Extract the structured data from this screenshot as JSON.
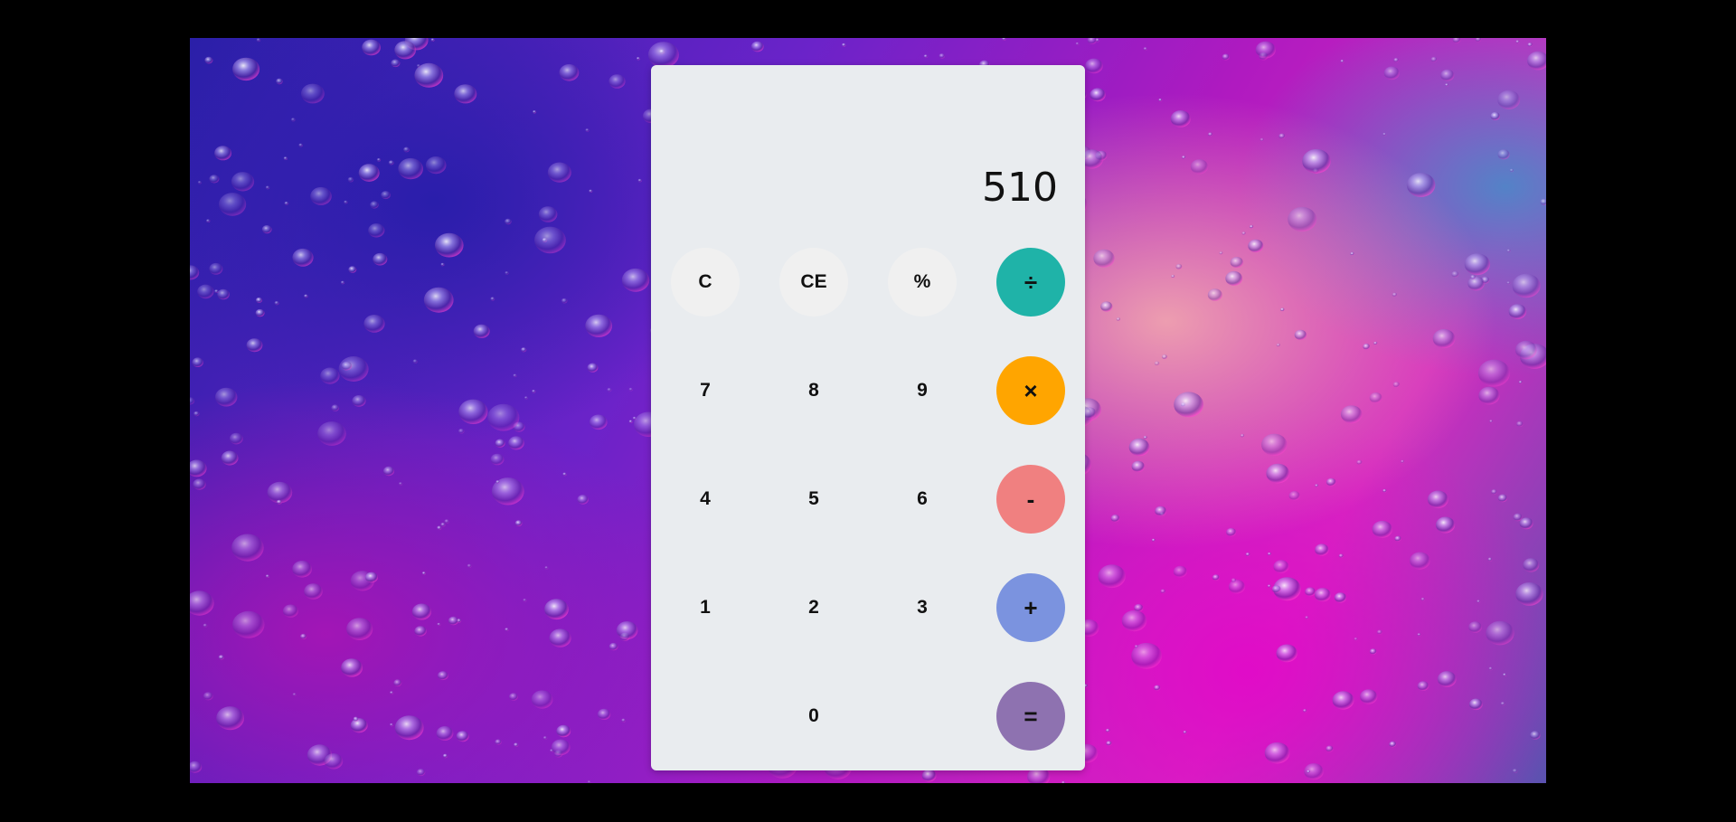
{
  "display": {
    "value": "510"
  },
  "keys": {
    "clear": "C",
    "clear_entry": "CE",
    "percent": "%",
    "divide": "÷",
    "seven": "7",
    "eight": "8",
    "nine": "9",
    "multiply": "×",
    "four": "4",
    "five": "5",
    "six": "6",
    "subtract": "-",
    "one": "1",
    "two": "2",
    "three": "3",
    "add": "+",
    "zero": "0",
    "equals": "="
  },
  "colors": {
    "divide": "#1fb3a8",
    "multiply": "#ffa500",
    "subtract": "#f08080",
    "add": "#7b93df",
    "equals": "#8e72b0",
    "panel": "#e9ecef",
    "util_key": "#f0f0f0"
  }
}
